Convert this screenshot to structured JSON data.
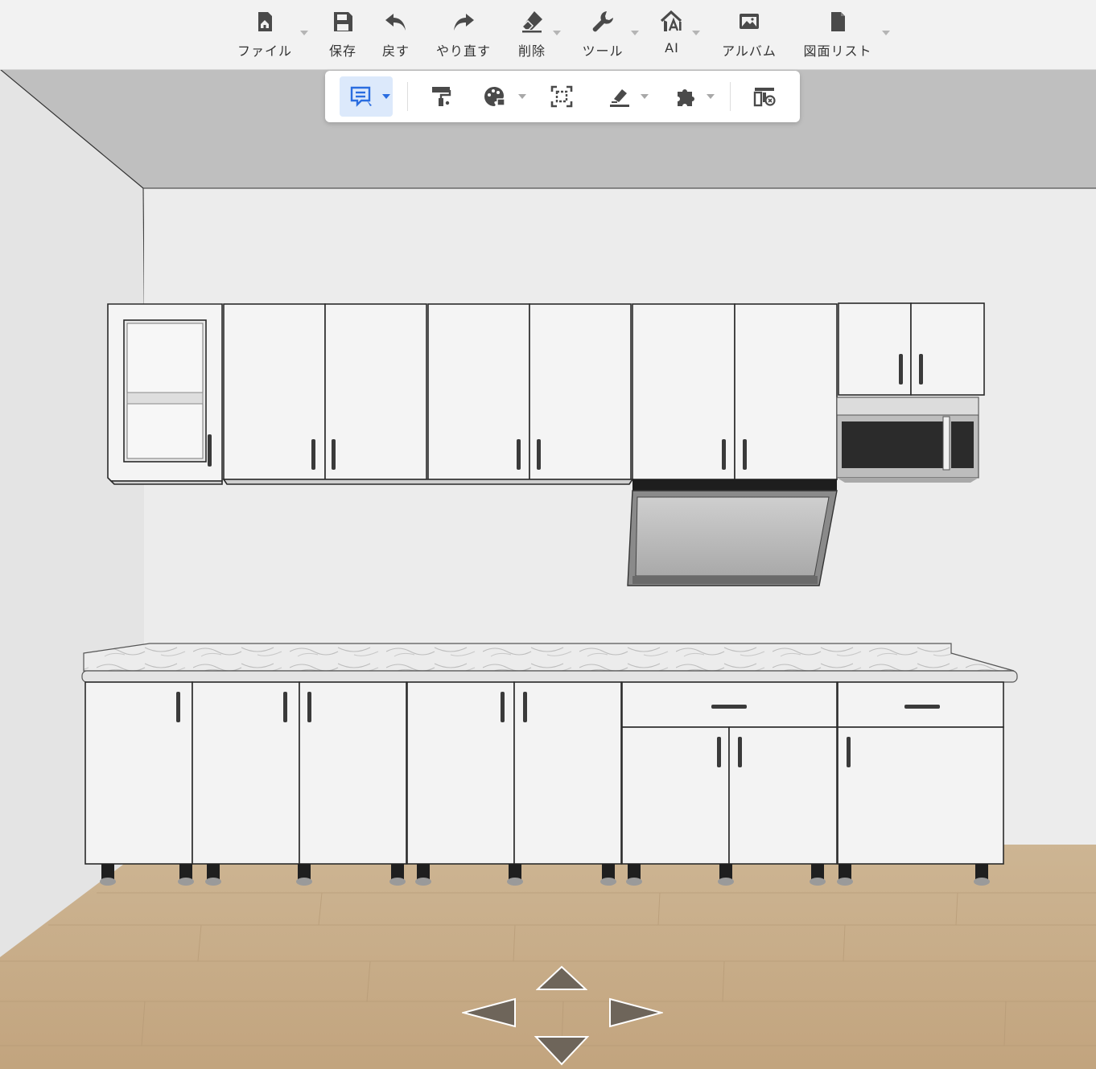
{
  "toolbar": {
    "file": "ファイル",
    "save": "保存",
    "undo": "戻す",
    "redo": "やり直す",
    "delete": "削除",
    "tools": "ツール",
    "ai": "AI",
    "album": "アルバム",
    "drawing_list": "図面リスト"
  },
  "colors": {
    "toolbar_bg": "#f2f2f2",
    "icon": "#4a4a4a",
    "active_bg": "#dce9fb",
    "active_icon": "#2a6de0",
    "cabinet": "#f4f4f4",
    "cabinet_line": "#2a2a2a",
    "floor": "#c9b08e",
    "wall": "#ececec",
    "ceiling": "#bdbdbd"
  },
  "icons": {
    "file": "home-doc-icon",
    "save": "floppy-icon",
    "undo": "undo-icon",
    "redo": "redo-icon",
    "delete": "eraser-icon",
    "tools": "wrench-icon",
    "ai": "ai-house-icon",
    "album": "image-icon",
    "drawing_list": "document-icon"
  }
}
